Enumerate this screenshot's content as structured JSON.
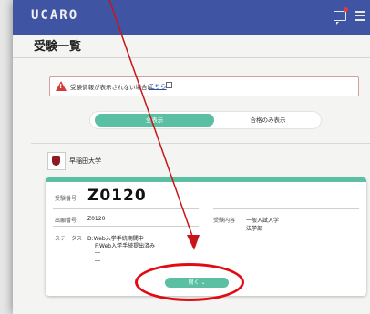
{
  "header": {
    "logo": "UCARO",
    "icons": [
      "message-icon",
      "menu-icon"
    ],
    "notify_color": "#e03a3a"
  },
  "page": {
    "title": "受験一覧"
  },
  "alert": {
    "text": "受験情報が表示されない場合は、",
    "link": "こちら"
  },
  "filter": {
    "all_label": "全表示",
    "pass_label": "合格のみ表示",
    "active": "all"
  },
  "university": {
    "name": "早稲田大学"
  },
  "exam_card": {
    "number_label": "受験番号",
    "number": "Z0120",
    "app_label": "出願番号",
    "app_number": "Z0120",
    "content_label": "受験内容",
    "content_line1": "一般入試入学",
    "content_line2": "法学部",
    "status_label": "ステータス",
    "status_lines": [
      "D:Web入学手続期間中",
      "F:Web入学手続提出済み",
      "―",
      "―"
    ],
    "open_button": "開く"
  },
  "colors": {
    "header_bg": "#3f55a3",
    "accent": "#5bbfa4",
    "annotation": "#e30b12"
  }
}
